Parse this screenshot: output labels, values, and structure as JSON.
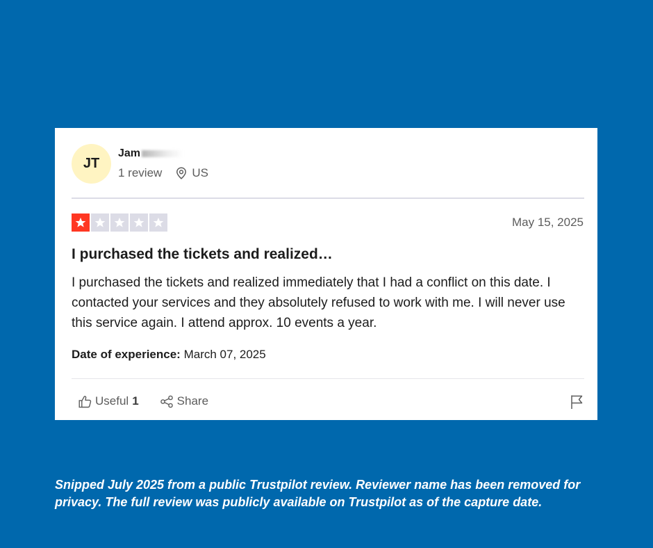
{
  "review": {
    "reviewer": {
      "initials": "JT",
      "name": "Jam",
      "review_count": "1 review",
      "country": "US",
      "avatar_color": "#fff4c2"
    },
    "rating": 1,
    "rating_max": 5,
    "star_color_on": "#ff3722",
    "star_color_off": "#dcdce6",
    "date": "May 15, 2025",
    "title": "I purchased the tickets and realized…",
    "body": "I purchased the tickets and realized immediately that I had a conflict on this date. I contacted your services and they absolutely refused to work with me. I will never use this service again. I attend approx. 10 events a year.",
    "experience_label": "Date of experience:",
    "experience_date": "March 07, 2025",
    "actions": {
      "useful_label": "Useful",
      "useful_count": "1",
      "share_label": "Share"
    },
    "icons": [
      "location-pin-icon",
      "star-icon",
      "thumbs-up-icon",
      "share-icon",
      "flag-icon"
    ]
  },
  "caption": "Snipped July 2025 from a public Trustpilot review. Reviewer name has been removed for privacy. The full review was publicly available on Trustpilot as of the capture date.",
  "colors": {
    "background": "#0068ad",
    "card": "#ffffff"
  }
}
